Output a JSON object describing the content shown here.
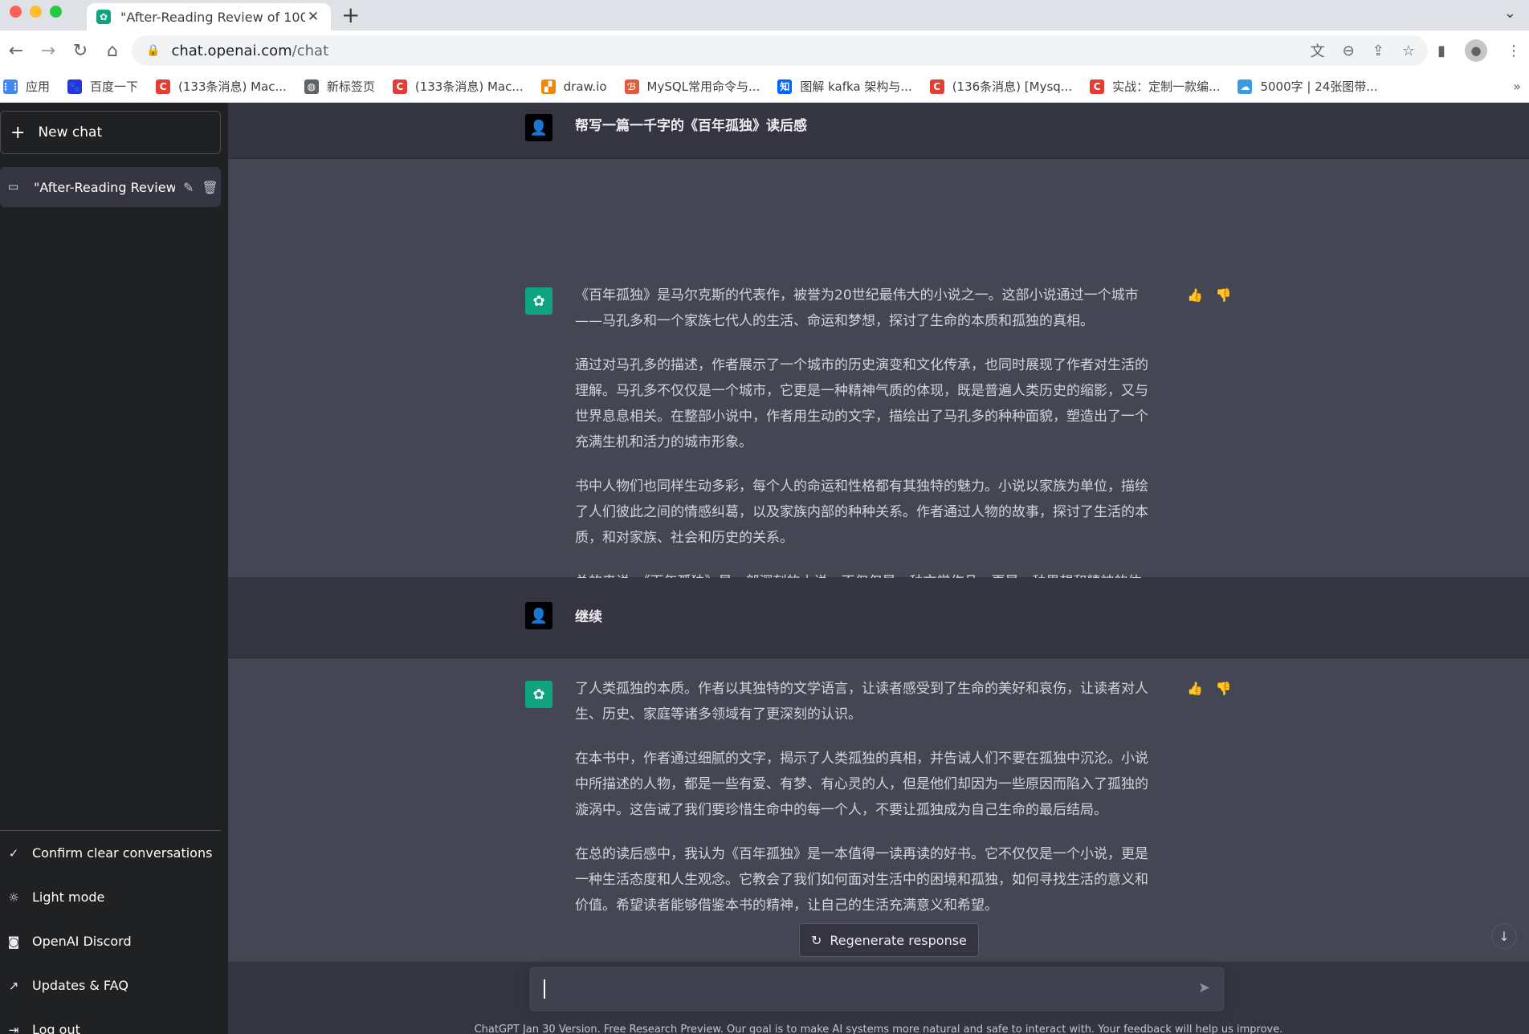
{
  "browser": {
    "tab_title": "\"After-Reading Review of 100",
    "url_host": "chat.openai.com",
    "url_path": "/chat",
    "bookmarks": [
      {
        "label": "应用",
        "icon": "apps-grid-icon",
        "color": "#4285f4",
        "glyph": "⋮⋮"
      },
      {
        "label": "百度一下",
        "icon": "baidu-paw-icon",
        "color": "#2932e1",
        "glyph": "🐾"
      },
      {
        "label": "(133条消息) Mac...",
        "icon": "csdn-icon",
        "color": "#e33e33",
        "glyph": "C"
      },
      {
        "label": "新标签页",
        "icon": "globe-icon",
        "color": "#5f6368",
        "glyph": "◍"
      },
      {
        "label": "(133条消息) Mac...",
        "icon": "csdn-icon",
        "color": "#e33e33",
        "glyph": "C"
      },
      {
        "label": "draw.io",
        "icon": "drawio-icon",
        "color": "#f08705",
        "glyph": "▞"
      },
      {
        "label": "MySQL常用命令与...",
        "icon": "jianshu-icon",
        "color": "#e05b3f",
        "glyph": "ℬ"
      },
      {
        "label": "图解 kafka 架构与...",
        "icon": "zhihu-icon",
        "color": "#0066ff",
        "glyph": "知"
      },
      {
        "label": "(136条消息) [Mysq...",
        "icon": "csdn-icon",
        "color": "#e33e33",
        "glyph": "C"
      },
      {
        "label": "实战：定制一款编...",
        "icon": "csdn-icon",
        "color": "#e33e33",
        "glyph": "C"
      },
      {
        "label": "5000字 | 24张图带...",
        "icon": "cloud-icon",
        "color": "#3b9ae1",
        "glyph": "☁"
      }
    ]
  },
  "sidebar": {
    "new_chat": "New chat",
    "conversation_title": "\"After-Reading Review",
    "bottom_items": [
      {
        "label": "Confirm clear conversations",
        "icon": "check-icon",
        "glyph": "✓"
      },
      {
        "label": "Light mode",
        "icon": "sun-icon",
        "glyph": "☼"
      },
      {
        "label": "OpenAI Discord",
        "icon": "discord-icon",
        "glyph": "◙"
      },
      {
        "label": "Updates & FAQ",
        "icon": "external-link-icon",
        "glyph": "↗"
      },
      {
        "label": "Log out",
        "icon": "logout-icon",
        "glyph": "⇥"
      }
    ]
  },
  "chat": {
    "user_message_1": "帮写一篇一千字的《百年孤独》读后感",
    "assistant_message_1": [
      "《百年孤独》是马尔克斯的代表作，被誉为20世纪最伟大的小说之一。这部小说通过一个城市——马孔多和一个家族七代人的生活、命运和梦想，探讨了生命的本质和孤独的真相。",
      "通过对马孔多的描述，作者展示了一个城市的历史演变和文化传承，也同时展现了作者对生活的理解。马孔多不仅仅是一个城市，它更是一种精神气质的体现，既是普遍人类历史的缩影，又与世界息息相关。在整部小说中，作者用生动的文字，描绘出了马孔多的种种面貌，塑造出了一个充满生机和活力的城市形象。",
      "书中人物们也同样生动多彩，每个人的命运和性格都有其独特的魅力。小说以家族为单位，描绘了人们彼此之间的情感纠葛，以及家族内部的种种关系。作者通过人物的故事，探讨了生活的本质，和对家族、社会和历史的关系。",
      "总的来说，《百年孤独》是一部深刻的小说，不仅仅是一种文学作品，更是一种思想和精神的体现。它引领读者思考生命的意义，并揭示"
    ],
    "user_message_2": "继续",
    "assistant_message_2": [
      "了人类孤独的本质。作者以其独特的文学语言，让读者感受到了生命的美好和哀伤，让读者对人生、历史、家庭等诸多领域有了更深刻的认识。",
      "在本书中，作者通过细腻的文字，揭示了人类孤独的真相，并告诫人们不要在孤独中沉沦。小说中所描述的人物，都是一些有爱、有梦、有心灵的人，但是他们却因为一些原因而陷入了孤独的漩涡中。这告诫了我们要珍惜生命中的每一个人，不要让孤独成为自己生命的最后结局。",
      "在总的读后感中，我认为《百年孤独》是一本值得一读再读的好书。它不仅仅是一个小说，更是一种生活态度和人生观念。它教会了我们如何面对生活中的困境和孤独，如何寻找生活的意义和价值。希望读者能够借鉴本书的精神，让自己的生活充满意义和希望。"
    ],
    "regenerate_label": "Regenerate response",
    "input_value": "",
    "footer": "ChatGPT Jan 30 Version. Free Research Preview. Our goal is to make AI systems more natural and safe to interact with. Your feedback will help us improve."
  },
  "colors": {
    "sidebar_bg": "#202123",
    "user_bg": "#343541",
    "assistant_bg": "#444654",
    "brand": "#10a37f"
  }
}
